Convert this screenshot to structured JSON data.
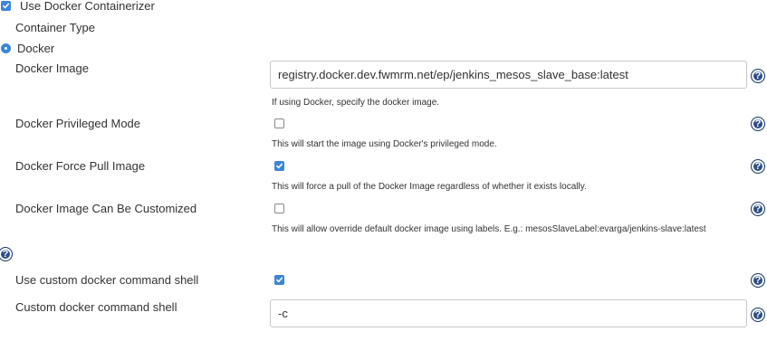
{
  "use_docker": {
    "label": "Use Docker Containerizer",
    "checked": true
  },
  "container_type": {
    "label": "Container Type",
    "option": "Docker",
    "selected": true
  },
  "docker_image": {
    "label": "Docker Image",
    "value": "registry.docker.dev.fwmrm.net/ep/jenkins_mesos_slave_base:latest",
    "description": "If using Docker, specify the docker image."
  },
  "privileged_mode": {
    "label": "Docker Privileged Mode",
    "checked": false,
    "description": "This will start the image using Docker's privileged mode."
  },
  "force_pull": {
    "label": "Docker Force Pull Image",
    "checked": true,
    "description": "This will force a pull of the Docker Image regardless of whether it exists locally."
  },
  "customizable": {
    "label": "Docker Image Can Be Customized",
    "checked": false,
    "description": "This will allow override default docker image using labels. E.g.: mesosSlaveLabel:evarga/jenkins-slave:latest"
  },
  "custom_shell": {
    "label": "Use custom docker command shell",
    "checked": true
  },
  "custom_shell_cmd": {
    "label": "Custom docker command shell",
    "value": "-c"
  },
  "help_glyph": "?",
  "colors": {
    "accent": "#3b86d8",
    "help": "#2c4f86",
    "text": "#333333",
    "border": "#c8c8c8"
  }
}
